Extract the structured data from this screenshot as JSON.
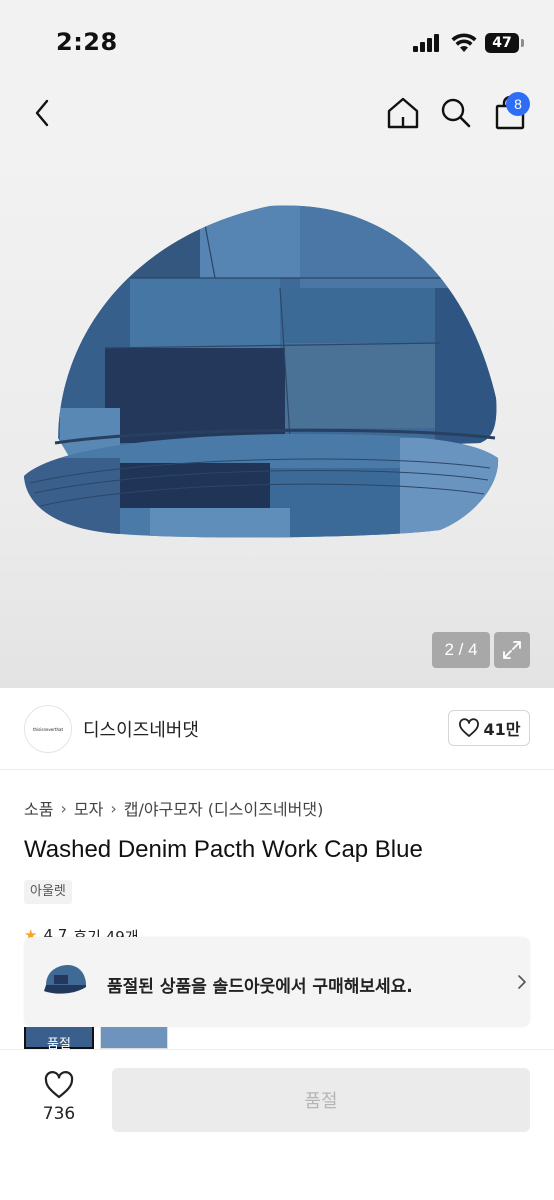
{
  "status_bar": {
    "time": "2:28",
    "battery": "47"
  },
  "nav": {
    "cart_count": "8"
  },
  "gallery": {
    "counter": "2 / 4"
  },
  "brand": {
    "logo_text": "thisisneverthat",
    "name": "디스이즈네버댓",
    "likes": "41만"
  },
  "breadcrumb": [
    "소품",
    "모자",
    "캡/야구모자 (디스이즈네버댓)"
  ],
  "product": {
    "title": "Washed Denim Pacth Work Cap Blue",
    "tag": "아울렛"
  },
  "rating_peek": {
    "score": "4.7",
    "label": "후기 49개"
  },
  "soldout_banner": {
    "text": "품절된 상품을 솔드아웃에서 구매해보세요."
  },
  "thumbnails": {
    "first_label": "품절"
  },
  "bottom_bar": {
    "wish_count": "736",
    "buy_label": "품절"
  },
  "colors": {
    "accent_badge": "#2f6df6",
    "star": "#f5a623",
    "disabled_button": "#ebebeb"
  }
}
